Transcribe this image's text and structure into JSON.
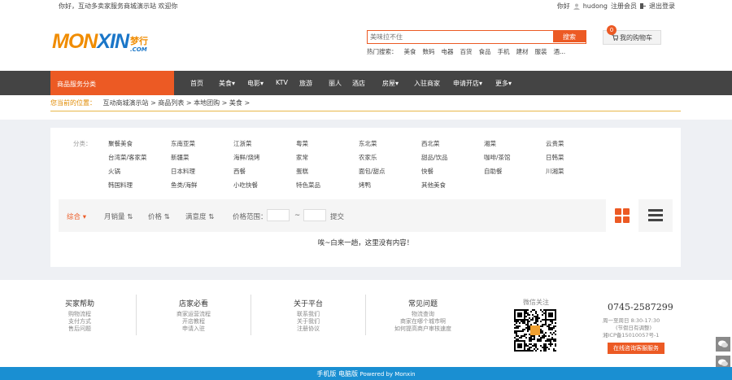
{
  "topbar": {
    "welcome": "你好，互动多卖家服务商城演示站 欢迎你",
    "greeting": "你好",
    "username": "hudong",
    "register": "注册会员",
    "logout": "退出登录"
  },
  "logo": {
    "part1": "MON",
    "part2": "XIN",
    "cn": "梦行",
    "com": ".COM"
  },
  "search": {
    "placeholder": "美味拉不住",
    "button": "搜索"
  },
  "hot": {
    "label": "热门搜索：",
    "items": [
      "美食",
      "数码",
      "电器",
      "百货",
      "食品",
      "手机",
      "建材",
      "服装",
      "酒..."
    ]
  },
  "cart": {
    "count": "0",
    "label": "我的购物车"
  },
  "nav": {
    "category": "商品服务分类",
    "items": [
      "首页",
      "美食",
      "电影",
      "KTV",
      "旅游",
      "丽人",
      "酒店",
      "房屋",
      "入驻商家",
      "申请开店",
      "更多"
    ]
  },
  "breadcrumb": {
    "label": "您当前的位置：",
    "path": "互动商城演示站 > 商品列表 > 本地团购 > 美食 >"
  },
  "tags": {
    "label": "分类：",
    "items": [
      "聚餐美食",
      "东南亚菜",
      "江浙菜",
      "粤菜",
      "东北菜",
      "西北菜",
      "湘菜",
      "云贵菜",
      "台湾菜/客家菜",
      "新疆菜",
      "海鲜/烧烤",
      "家常",
      "农家乐",
      "甜品/饮品",
      "咖啡/茶馆",
      "日韩菜",
      "火锅",
      "日本料理",
      "西餐",
      "蛋糕",
      "面包/甜点",
      "快餐",
      "自助餐",
      "川湘菜",
      "韩国料理",
      "鱼类/海鲜",
      "小吃快餐",
      "特色菜品",
      "烤鸭",
      "其他美食"
    ]
  },
  "sort": {
    "comprehensive": "综合",
    "monthly_sales": "月销量",
    "price": "价格",
    "satisfaction": "满意度",
    "price_range": "价格范围：",
    "dash": "~",
    "submit": "提交"
  },
  "empty_message": "唉~白来一趟，这里没有内容！",
  "footer": {
    "cols": [
      {
        "title": "买家帮助",
        "links": [
          "购物流程",
          "支付方式",
          "售后问题"
        ]
      },
      {
        "title": "店家必看",
        "links": [
          "商家运营流程",
          "开店教程",
          "申请入驻"
        ]
      },
      {
        "title": "关于平台",
        "links": [
          "联系我们",
          "关于我们",
          "注册协议"
        ]
      },
      {
        "title": "常见问题",
        "links": [
          "物流查询",
          "商家在哪个城市啊",
          "如何提高商户审核速度"
        ]
      }
    ],
    "qr_label": "微信关注",
    "phone": "0745-2587299",
    "hours": "周一至周日 8:30-17:30",
    "note": "(节假日有调整)",
    "icp": "湘ICP备15010057号-1",
    "call_button": "在线咨询客服服务"
  },
  "bottombar": {
    "mobile": "手机版",
    "pc": "电脑版",
    "powered": "Powered by Monxin"
  },
  "colors": {
    "accent": "#ec5a24",
    "nav_bg": "#444444",
    "footer_bar": "#1a8fd2"
  }
}
